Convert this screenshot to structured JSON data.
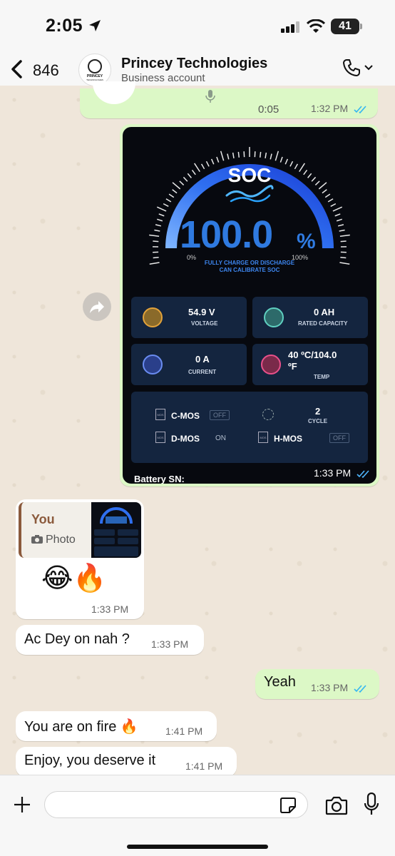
{
  "status_bar": {
    "time": "2:05",
    "battery": "41"
  },
  "header": {
    "back_count": "846",
    "contact_name": "Princey Technologies",
    "contact_subtitle": "Business account",
    "avatar_text": "PRINCEY",
    "avatar_sub": "TECHNOLOGIES"
  },
  "messages": {
    "voice": {
      "duration": "0:05",
      "time": "1:32 PM"
    },
    "image": {
      "time": "1:33 PM",
      "screen": {
        "title": "SOC",
        "value": "100.0",
        "unit": "%",
        "min_label": "0%",
        "max_label": "100%",
        "calibrate_note_1": "FULLY CHARGE OR DISCHARGE",
        "calibrate_note_2": "CAN CALIBRATE SOC",
        "voltage_value": "54.9 V",
        "voltage_label": "VOLTAGE",
        "capacity_value": "0 AH",
        "capacity_label": "RATED CAPACITY",
        "current_value": "0 A",
        "current_label": "CURRENT",
        "temp_value": "40 ºC/104.0",
        "temp_value_2": "ºF",
        "temp_label": "TEMP",
        "cmos_label": "C-MOS",
        "cmos_state": "OFF",
        "dmos_label": "D-MOS",
        "dmos_state": "ON",
        "cycle_value": "2",
        "cycle_label": "CYCLE",
        "hmos_label": "H-MOS",
        "hmos_state": "OFF",
        "chip_label": "MOS",
        "battery_sn": "Battery SN:"
      }
    },
    "reply": {
      "quote_author": "You",
      "quote_type": "Photo",
      "emojis": "😂🔥",
      "time": "1:33 PM"
    },
    "list": [
      {
        "text": "Ac Dey on nah ?",
        "time": "1:33 PM",
        "direction": "in"
      },
      {
        "text": "Yeah",
        "time": "1:33 PM",
        "direction": "out"
      },
      {
        "text": "You are on fire 🔥",
        "time": "1:41 PM",
        "direction": "in"
      },
      {
        "text": "Enjoy, you deserve it",
        "time": "1:41 PM",
        "direction": "in"
      }
    ]
  },
  "input": {
    "placeholder": "",
    "value": ""
  },
  "colors": {
    "outgoing": "#dcf8c6",
    "incoming": "#ffffff",
    "read_ticks": "#34b7f1",
    "gauge_blue": "#2f7ae0"
  }
}
